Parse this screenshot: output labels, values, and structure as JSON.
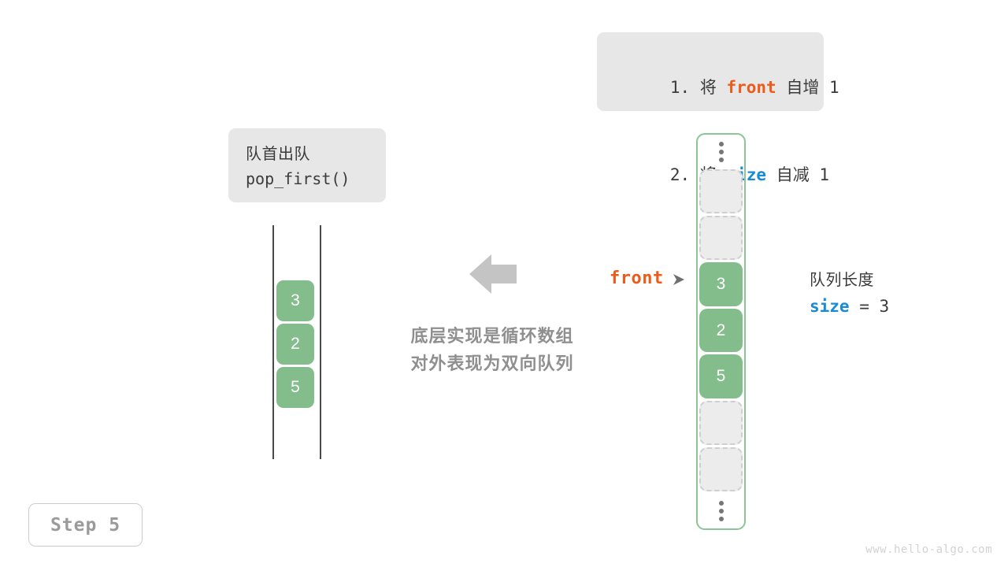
{
  "operation_box": {
    "title_cn": "队首出队",
    "method": "pop_first()"
  },
  "steps_box": {
    "lines": [
      {
        "index": "1.",
        "prefix": "将",
        "keyword": "front",
        "keyword_color": "#ec5b19",
        "suffix": "自增",
        "value": "1"
      },
      {
        "index": "2.",
        "prefix": "将",
        "keyword": "size",
        "keyword_color": "#1a8ad4",
        "suffix": "自减",
        "value": "1"
      }
    ]
  },
  "caption": {
    "line1": "底层实现是循环数组",
    "line2": "对外表现为双向队列"
  },
  "deque_view": {
    "cells": [
      "3",
      "2",
      "5"
    ]
  },
  "circular_array": {
    "top_ellipsis": "⋮",
    "bottom_ellipsis": "⋮",
    "slots": [
      {
        "value": "",
        "state": "empty"
      },
      {
        "value": "",
        "state": "empty"
      },
      {
        "value": "3",
        "state": "filled"
      },
      {
        "value": "2",
        "state": "filled"
      },
      {
        "value": "5",
        "state": "filled"
      },
      {
        "value": "",
        "state": "empty"
      },
      {
        "value": "",
        "state": "empty"
      }
    ]
  },
  "front_pointer": {
    "label": "front"
  },
  "size_note": {
    "title_cn": "队列长度",
    "var_name": "size",
    "equals": " = ",
    "value": "3"
  },
  "step_badge": {
    "label": "Step 5"
  },
  "watermark": {
    "text": "www.hello-algo.com"
  },
  "colors": {
    "cell_green": "#83bd8c",
    "array_border": "#8cc596",
    "front_orange": "#ec5b19",
    "size_blue": "#1a8ad4",
    "box_gray": "#e7e7e7",
    "caption_gray": "#8f8f8f",
    "arrow_gray": "#c4c4c4"
  }
}
